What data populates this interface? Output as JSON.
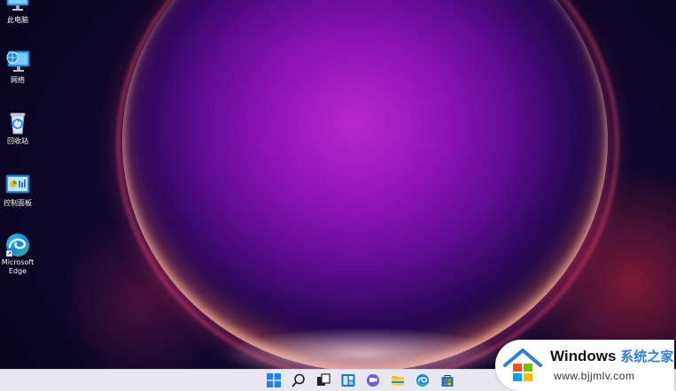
{
  "desktop": {
    "icons": [
      {
        "label": "此电脑",
        "icon": "computer-icon"
      },
      {
        "label": "网络",
        "icon": "network-icon"
      },
      {
        "label": "回收站",
        "icon": "recycle-bin-icon"
      },
      {
        "label": "控制面板",
        "icon": "control-panel-icon"
      },
      {
        "label": "Microsoft Edge",
        "icon": "edge-icon"
      }
    ]
  },
  "taskbar": {
    "icons": [
      "start-icon",
      "search-icon",
      "task-view-icon",
      "widgets-icon",
      "chat-icon",
      "file-explorer-icon",
      "edge-icon",
      "store-icon"
    ]
  },
  "watermark": {
    "title": "Windows",
    "title_cn": "系统之家",
    "url": "www.bjjmlv.com"
  },
  "colors": {
    "taskbar_bg": "#e8e6ee",
    "windows_blue": "#1f86e8",
    "brand_blue": "#2d7fd6"
  }
}
